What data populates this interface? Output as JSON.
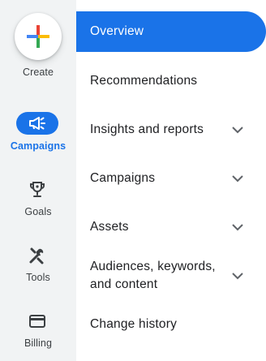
{
  "rail": {
    "create_label": "Create",
    "items": [
      {
        "label": "Campaigns",
        "icon": "megaphone-icon",
        "active": true
      },
      {
        "label": "Goals",
        "icon": "trophy-icon"
      },
      {
        "label": "Tools",
        "icon": "tools-icon"
      },
      {
        "label": "Billing",
        "icon": "credit-card-icon"
      }
    ]
  },
  "menu": {
    "items": [
      {
        "label": "Overview",
        "active": true
      },
      {
        "label": "Recommendations"
      },
      {
        "label": "Insights and reports",
        "expandable": true
      },
      {
        "label": "Campaigns",
        "expandable": true
      },
      {
        "label": "Assets",
        "expandable": true
      },
      {
        "label": "Audiences, keywords,\nand content",
        "expandable": true
      },
      {
        "label": "Change history"
      }
    ]
  },
  "colors": {
    "accent": "#1a73e8",
    "rail_bg": "#f1f3f4",
    "plus_blue": "#4285f4",
    "plus_red": "#ea4335",
    "plus_yellow": "#fbbc04",
    "plus_green": "#34a853"
  }
}
